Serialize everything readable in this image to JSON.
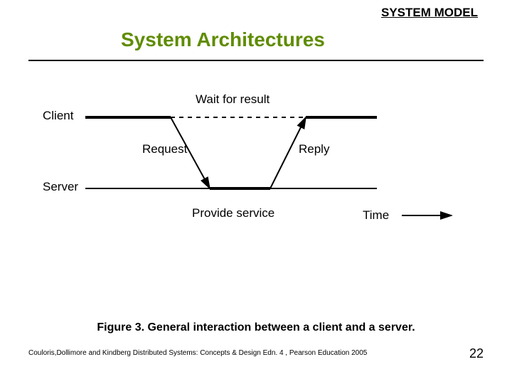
{
  "heading": "SYSTEM MODEL",
  "title": "System Architectures",
  "diagram": {
    "client_label": "Client",
    "server_label": "Server",
    "wait_label": "Wait for result",
    "request_label": "Request",
    "reply_label": "Reply",
    "provide_label": "Provide service",
    "time_label": "Time"
  },
  "caption": "Figure 3. General interaction between a client and a server.",
  "credit": "Couloris,Dollimore and Kindberg  Distributed Systems: Concepts & Design  Edn. 4 , Pearson Education 2005",
  "page": "22"
}
